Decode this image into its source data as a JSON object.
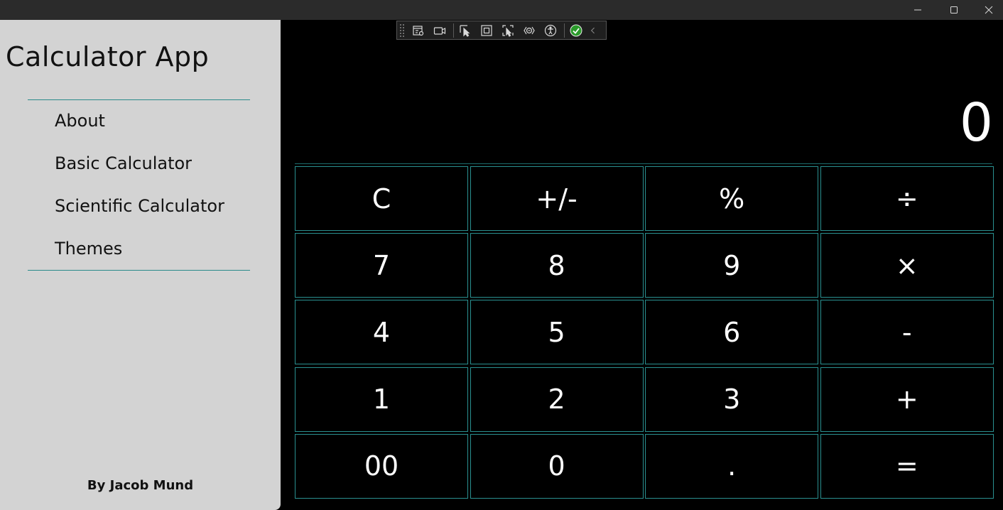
{
  "window": {
    "controls": {
      "minimize": "minimize-icon",
      "maximize": "maximize-icon",
      "close": "close-icon"
    }
  },
  "sidebar": {
    "title": "Calculator App",
    "nav": [
      {
        "label": "About"
      },
      {
        "label": "Basic Calculator"
      },
      {
        "label": "Scientific Calculator"
      },
      {
        "label": "Themes"
      }
    ],
    "footer": "By Jacob Mund"
  },
  "dev_toolbar": {
    "icons": [
      "live-visual-tree-icon",
      "record-icon",
      "select-element-icon",
      "display-layout-adorners-icon",
      "track-focused-element-icon",
      "binding-failures-icon",
      "accessibility-icon",
      "check-icon",
      "collapse-chevron-icon"
    ]
  },
  "calculator": {
    "display_value": "0",
    "keys": [
      "C",
      "+/-",
      "%",
      "÷",
      "7",
      "8",
      "9",
      "×",
      "4",
      "5",
      "6",
      "-",
      "1",
      "2",
      "3",
      "+",
      "00",
      "0",
      ".",
      "="
    ]
  },
  "colors": {
    "sidebar_bg": "#d3d3d3",
    "accent": "#2a9090",
    "background": "#000000",
    "titlebar": "#2b2b2b"
  }
}
